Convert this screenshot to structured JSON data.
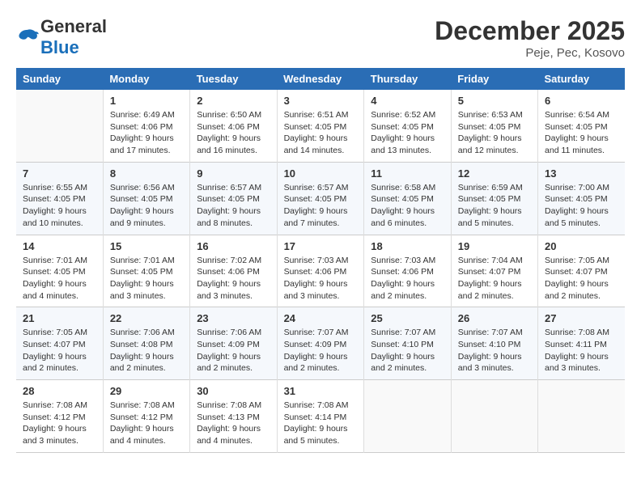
{
  "header": {
    "logo_general": "General",
    "logo_blue": "Blue",
    "month_year": "December 2025",
    "location": "Peje, Pec, Kosovo"
  },
  "columns": [
    "Sunday",
    "Monday",
    "Tuesday",
    "Wednesday",
    "Thursday",
    "Friday",
    "Saturday"
  ],
  "weeks": [
    [
      {
        "day": "",
        "info": ""
      },
      {
        "day": "1",
        "info": "Sunrise: 6:49 AM\nSunset: 4:06 PM\nDaylight: 9 hours\nand 17 minutes."
      },
      {
        "day": "2",
        "info": "Sunrise: 6:50 AM\nSunset: 4:06 PM\nDaylight: 9 hours\nand 16 minutes."
      },
      {
        "day": "3",
        "info": "Sunrise: 6:51 AM\nSunset: 4:05 PM\nDaylight: 9 hours\nand 14 minutes."
      },
      {
        "day": "4",
        "info": "Sunrise: 6:52 AM\nSunset: 4:05 PM\nDaylight: 9 hours\nand 13 minutes."
      },
      {
        "day": "5",
        "info": "Sunrise: 6:53 AM\nSunset: 4:05 PM\nDaylight: 9 hours\nand 12 minutes."
      },
      {
        "day": "6",
        "info": "Sunrise: 6:54 AM\nSunset: 4:05 PM\nDaylight: 9 hours\nand 11 minutes."
      }
    ],
    [
      {
        "day": "7",
        "info": "Sunrise: 6:55 AM\nSunset: 4:05 PM\nDaylight: 9 hours\nand 10 minutes."
      },
      {
        "day": "8",
        "info": "Sunrise: 6:56 AM\nSunset: 4:05 PM\nDaylight: 9 hours\nand 9 minutes."
      },
      {
        "day": "9",
        "info": "Sunrise: 6:57 AM\nSunset: 4:05 PM\nDaylight: 9 hours\nand 8 minutes."
      },
      {
        "day": "10",
        "info": "Sunrise: 6:57 AM\nSunset: 4:05 PM\nDaylight: 9 hours\nand 7 minutes."
      },
      {
        "day": "11",
        "info": "Sunrise: 6:58 AM\nSunset: 4:05 PM\nDaylight: 9 hours\nand 6 minutes."
      },
      {
        "day": "12",
        "info": "Sunrise: 6:59 AM\nSunset: 4:05 PM\nDaylight: 9 hours\nand 5 minutes."
      },
      {
        "day": "13",
        "info": "Sunrise: 7:00 AM\nSunset: 4:05 PM\nDaylight: 9 hours\nand 5 minutes."
      }
    ],
    [
      {
        "day": "14",
        "info": "Sunrise: 7:01 AM\nSunset: 4:05 PM\nDaylight: 9 hours\nand 4 minutes."
      },
      {
        "day": "15",
        "info": "Sunrise: 7:01 AM\nSunset: 4:05 PM\nDaylight: 9 hours\nand 3 minutes."
      },
      {
        "day": "16",
        "info": "Sunrise: 7:02 AM\nSunset: 4:06 PM\nDaylight: 9 hours\nand 3 minutes."
      },
      {
        "day": "17",
        "info": "Sunrise: 7:03 AM\nSunset: 4:06 PM\nDaylight: 9 hours\nand 3 minutes."
      },
      {
        "day": "18",
        "info": "Sunrise: 7:03 AM\nSunset: 4:06 PM\nDaylight: 9 hours\nand 2 minutes."
      },
      {
        "day": "19",
        "info": "Sunrise: 7:04 AM\nSunset: 4:07 PM\nDaylight: 9 hours\nand 2 minutes."
      },
      {
        "day": "20",
        "info": "Sunrise: 7:05 AM\nSunset: 4:07 PM\nDaylight: 9 hours\nand 2 minutes."
      }
    ],
    [
      {
        "day": "21",
        "info": "Sunrise: 7:05 AM\nSunset: 4:07 PM\nDaylight: 9 hours\nand 2 minutes."
      },
      {
        "day": "22",
        "info": "Sunrise: 7:06 AM\nSunset: 4:08 PM\nDaylight: 9 hours\nand 2 minutes."
      },
      {
        "day": "23",
        "info": "Sunrise: 7:06 AM\nSunset: 4:09 PM\nDaylight: 9 hours\nand 2 minutes."
      },
      {
        "day": "24",
        "info": "Sunrise: 7:07 AM\nSunset: 4:09 PM\nDaylight: 9 hours\nand 2 minutes."
      },
      {
        "day": "25",
        "info": "Sunrise: 7:07 AM\nSunset: 4:10 PM\nDaylight: 9 hours\nand 2 minutes."
      },
      {
        "day": "26",
        "info": "Sunrise: 7:07 AM\nSunset: 4:10 PM\nDaylight: 9 hours\nand 3 minutes."
      },
      {
        "day": "27",
        "info": "Sunrise: 7:08 AM\nSunset: 4:11 PM\nDaylight: 9 hours\nand 3 minutes."
      }
    ],
    [
      {
        "day": "28",
        "info": "Sunrise: 7:08 AM\nSunset: 4:12 PM\nDaylight: 9 hours\nand 3 minutes."
      },
      {
        "day": "29",
        "info": "Sunrise: 7:08 AM\nSunset: 4:12 PM\nDaylight: 9 hours\nand 4 minutes."
      },
      {
        "day": "30",
        "info": "Sunrise: 7:08 AM\nSunset: 4:13 PM\nDaylight: 9 hours\nand 4 minutes."
      },
      {
        "day": "31",
        "info": "Sunrise: 7:08 AM\nSunset: 4:14 PM\nDaylight: 9 hours\nand 5 minutes."
      },
      {
        "day": "",
        "info": ""
      },
      {
        "day": "",
        "info": ""
      },
      {
        "day": "",
        "info": ""
      }
    ]
  ]
}
